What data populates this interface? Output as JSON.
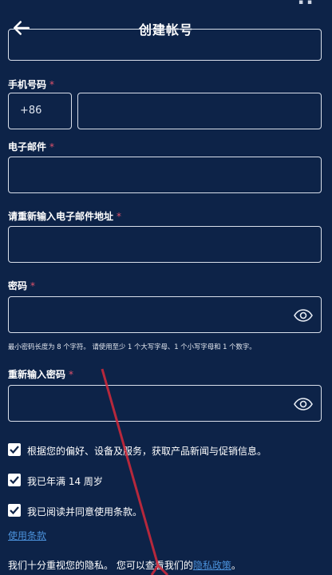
{
  "header": {
    "title": "创建帐号"
  },
  "form": {
    "phone": {
      "label": "手机号码",
      "required_mark": "*",
      "country_code": "+86",
      "value": ""
    },
    "email": {
      "label": "电子邮件",
      "required_mark": "*",
      "value": ""
    },
    "email_confirm": {
      "label": "请重新输入电子邮件地址",
      "required_mark": "*",
      "value": ""
    },
    "password": {
      "label": "密码",
      "required_mark": "*",
      "value": "",
      "hint": "最小密码长度为 8 个字符。 请使用至少 1 个大写字母、1 个小写字母和 1 个数字。"
    },
    "password_confirm": {
      "label": "重新输入密码",
      "required_mark": "*",
      "value": ""
    }
  },
  "checkboxes": [
    {
      "label": "根据您的偏好、设备及服务，获取产品新闻与促销信息。",
      "checked": true
    },
    {
      "label": "我已年满 14 周岁",
      "checked": true
    },
    {
      "label": "我已阅读并同意使用条款。",
      "checked": true
    }
  ],
  "links": {
    "terms": "使用条款",
    "privacy_prefix": "我们十分重视您的隐私。 您可以查看我们的",
    "privacy_link": "隐私政策",
    "privacy_suffix": "。"
  },
  "colors": {
    "background": "#0d2348",
    "field_border": "#d9dfea",
    "required": "#e0526b",
    "link": "#4a90d9"
  },
  "icons": {
    "back": "arrow-left-icon",
    "show_password": "eye-icon",
    "check": "check-icon"
  }
}
